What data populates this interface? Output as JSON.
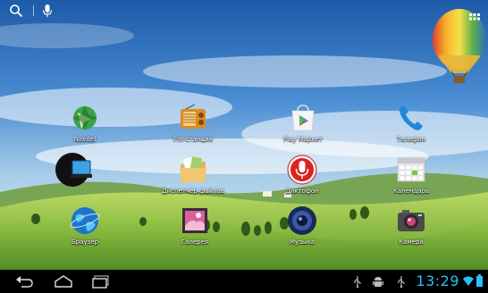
{
  "status_bar": {
    "time": "13:29"
  },
  "apps": [
    {
      "id": "navitel",
      "label": "Navitel",
      "icon": "navitel-globe-icon"
    },
    {
      "id": "radio",
      "label": "Fm-станция",
      "icon": "radio-icon"
    },
    {
      "id": "play",
      "label": "Play Маркет",
      "icon": "play-store-icon"
    },
    {
      "id": "phone",
      "label": "Телефон",
      "icon": "phone-handset-icon"
    },
    {
      "id": "screen",
      "label": "",
      "icon": "screen-cast-icon"
    },
    {
      "id": "files",
      "label": "Диспетчер файлов",
      "icon": "file-manager-icon"
    },
    {
      "id": "recorder",
      "label": "Диктофон",
      "icon": "microphone-icon"
    },
    {
      "id": "calendar",
      "label": "Календарь",
      "icon": "calendar-icon"
    },
    {
      "id": "browser",
      "label": "Браузер",
      "icon": "globe-icon"
    },
    {
      "id": "gallery",
      "label": "Галерея",
      "icon": "gallery-icon"
    },
    {
      "id": "music",
      "label": "Музыка",
      "icon": "speaker-icon"
    },
    {
      "id": "camera",
      "label": "Камера",
      "icon": "camera-icon"
    }
  ],
  "colors": {
    "clock": "#27c1f5",
    "navbar": "#000000"
  }
}
